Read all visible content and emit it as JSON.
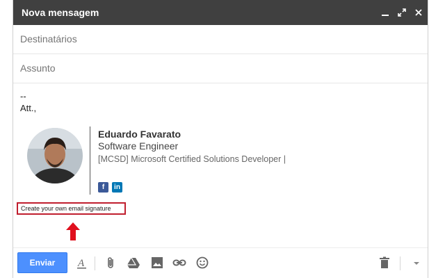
{
  "window": {
    "title": "Nova mensagem",
    "controls": [
      "minimize-icon",
      "expand-icon",
      "close-icon"
    ]
  },
  "fields": {
    "recipients_placeholder": "Destinatários",
    "subject_placeholder": "Assunto"
  },
  "body": {
    "line1": "--",
    "line2": "Att.,"
  },
  "signature": {
    "name": "Eduardo Favarato",
    "role": "Software Engineer",
    "certification": "[MCSD] Microsoft Certified Solutions Developer |",
    "social": [
      {
        "icon": "facebook-icon",
        "label": "f"
      },
      {
        "icon": "linkedin-icon",
        "label": "in"
      }
    ]
  },
  "create_link": "Create your own email signature",
  "colors": {
    "titlebar": "#404040",
    "send_button": "#4d90fe",
    "highlight_border": "#c01e2e",
    "arrow": "#e0101e"
  },
  "toolbar": {
    "send_label": "Enviar",
    "tools": [
      "text-format-icon",
      "attach-icon",
      "drive-icon",
      "photo-icon",
      "link-icon",
      "emoji-icon",
      "trash-icon",
      "more-options-icon"
    ]
  }
}
